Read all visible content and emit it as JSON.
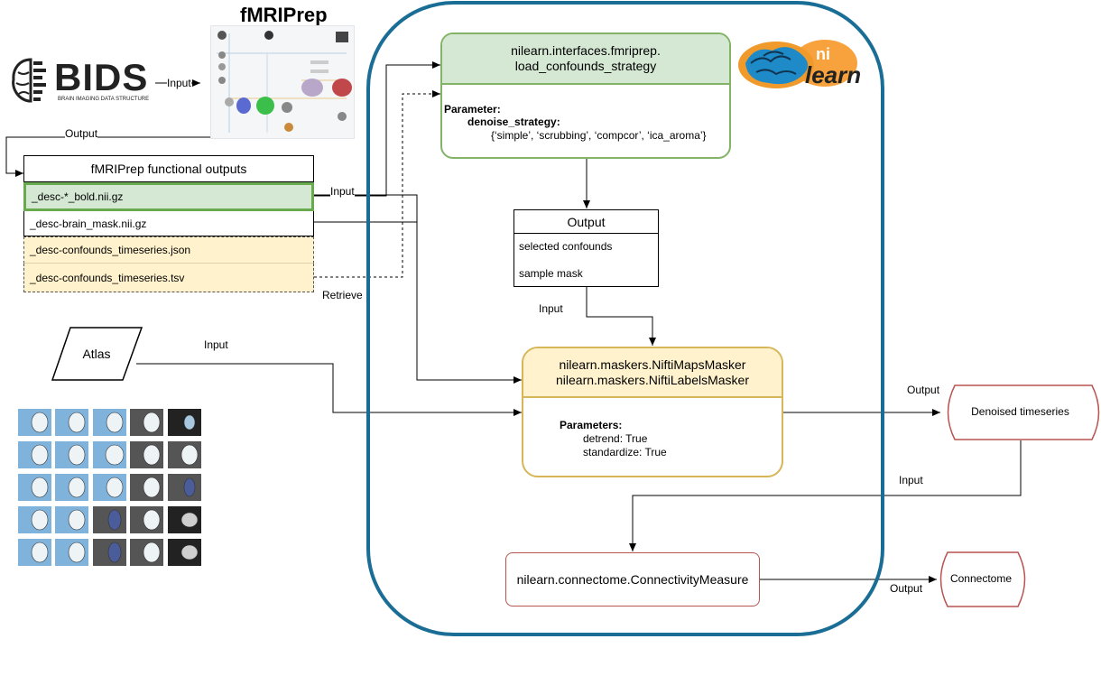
{
  "fmriprep": {
    "title": "fMRIPrep"
  },
  "bids": {
    "logo_text": "BIDS",
    "subtitle": "BRAIN IMAGING DATA STRUCTURE"
  },
  "nilearn_logo": {
    "ni": "ni",
    "learn": "learn"
  },
  "outputs_table": {
    "title": "fMRIPrep functional outputs",
    "rows": [
      {
        "label": "_desc-*_bold.nii.gz"
      },
      {
        "label": "_desc-brain_mask.nii.gz"
      },
      {
        "label": "_desc-confounds_timeseries.json"
      },
      {
        "label": "_desc-confounds_timeseries.tsv"
      }
    ]
  },
  "load_confounds": {
    "title_line1": "nilearn.interfaces.fmriprep.",
    "title_line2": "load_confounds_strategy",
    "param_heading": "Parameter:",
    "param_name": "denoise_strategy:",
    "param_values": "{‘simple’, ‘scrubbing’, ‘compcor’, ‘ica_aroma’}"
  },
  "output_box": {
    "title": "Output",
    "item1": "selected confounds",
    "item2": "sample mask"
  },
  "masker": {
    "line1": "nilearn.maskers.NiftiMapsMasker",
    "line2": "nilearn.maskers.NiftiLabelsMasker",
    "param_heading": "Parameters:",
    "param1": "detrend: True",
    "param2": "standardize: True"
  },
  "atlas": {
    "label": "Atlas"
  },
  "denoised": {
    "label": "Denoised timeseries"
  },
  "connectivity": {
    "label": "nilearn.connectome.ConnectivityMeasure"
  },
  "connectome": {
    "label": "Connectome"
  },
  "edge_labels": {
    "bids_input": "Input",
    "fmriprep_output": "Output",
    "bold_input": "Input",
    "retrieve": "Retrieve",
    "output_input": "Input",
    "atlas_input": "Input",
    "masker_output": "Output",
    "denoised_input": "Input",
    "connectome_output": "Output"
  },
  "colors": {
    "blue_frame": "#1a6e96",
    "green_fill": "#d5e8d4",
    "green_border": "#82b366",
    "yellow_fill": "#fff2cc",
    "yellow_border": "#d6b656",
    "red_border": "#b85450",
    "bold_row_border": "#6aaa4f"
  }
}
